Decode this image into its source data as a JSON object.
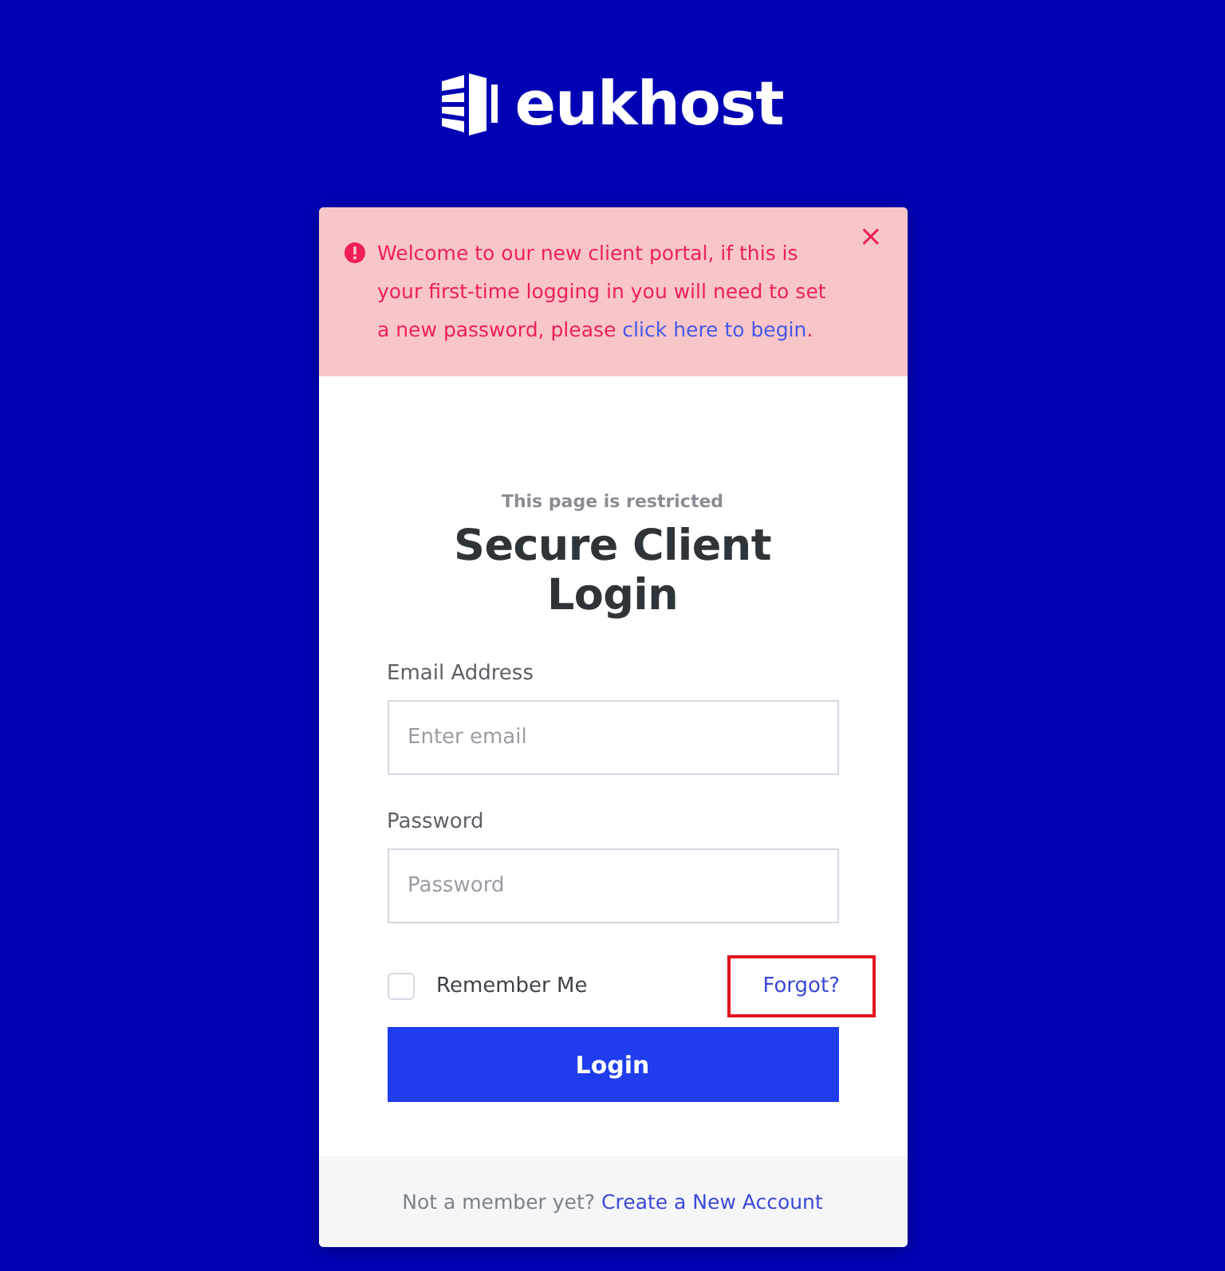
{
  "logo": {
    "text": "eukhost"
  },
  "alert": {
    "text_before": "Welcome to our new client portal, if this is your first-time logging in you will need to set a new password, please ",
    "link": "click here to begin",
    "text_after": ".",
    "close": "×"
  },
  "login": {
    "subtitle": "This page is restricted",
    "title": "Secure Client Login",
    "fields": [
      {
        "label": "Email Address",
        "placeholder": "Enter email"
      },
      {
        "label": "Password",
        "placeholder": "Password"
      }
    ],
    "remember": {
      "label": "Remember Me",
      "checked": false
    },
    "forgot": {
      "label": "Forgot?",
      "highlighted": true
    },
    "button": "Login"
  },
  "footer": {
    "text": "Not a member yet?",
    "link": "Create a New Account"
  }
}
